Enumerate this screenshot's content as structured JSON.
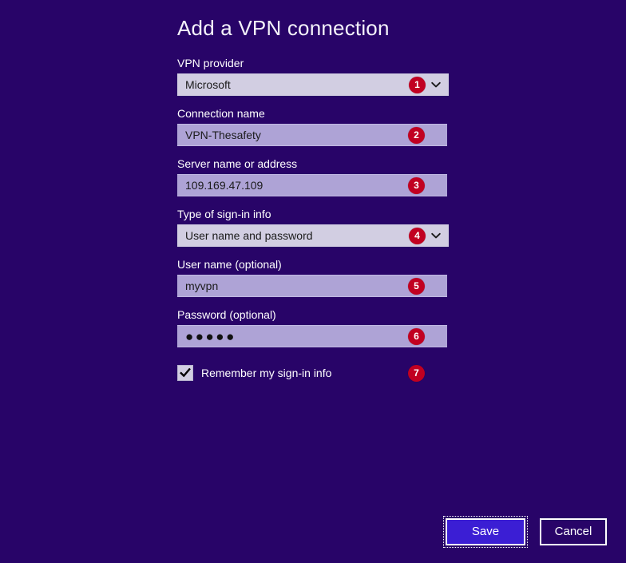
{
  "dialog": {
    "title": "Add a VPN connection"
  },
  "fields": [
    {
      "label": "VPN provider",
      "value": "Microsoft",
      "type": "combo",
      "badge": "1",
      "name": "vpn-provider"
    },
    {
      "label": "Connection name",
      "value": "VPN-Thesafety",
      "type": "text",
      "badge": "2",
      "name": "connection-name"
    },
    {
      "label": "Server name or address",
      "value": "109.169.47.109",
      "type": "text",
      "badge": "3",
      "name": "server-name"
    },
    {
      "label": "Type of sign-in info",
      "value": "User name and password",
      "type": "combo",
      "badge": "4",
      "name": "sign-in-info-type"
    },
    {
      "label": "User name (optional)",
      "value": "myvpn",
      "type": "text",
      "badge": "5",
      "name": "user-name"
    },
    {
      "label": "Password (optional)",
      "value": "●●●●●",
      "type": "password",
      "badge": "6",
      "name": "password"
    }
  ],
  "remember": {
    "label": "Remember my sign-in info",
    "checked": true,
    "badge": "7"
  },
  "footer": {
    "save_label": "Save",
    "cancel_label": "Cancel"
  },
  "icons": {
    "chevron_down": "chevron-down-icon",
    "check": "check-icon"
  },
  "colors": {
    "background": "#280468",
    "combo_fill": "#d2cee2",
    "text_fill": "#aea3d6",
    "badge_red": "#c10021",
    "save_fill": "#3b1ed4",
    "border_white": "#ffffff"
  }
}
